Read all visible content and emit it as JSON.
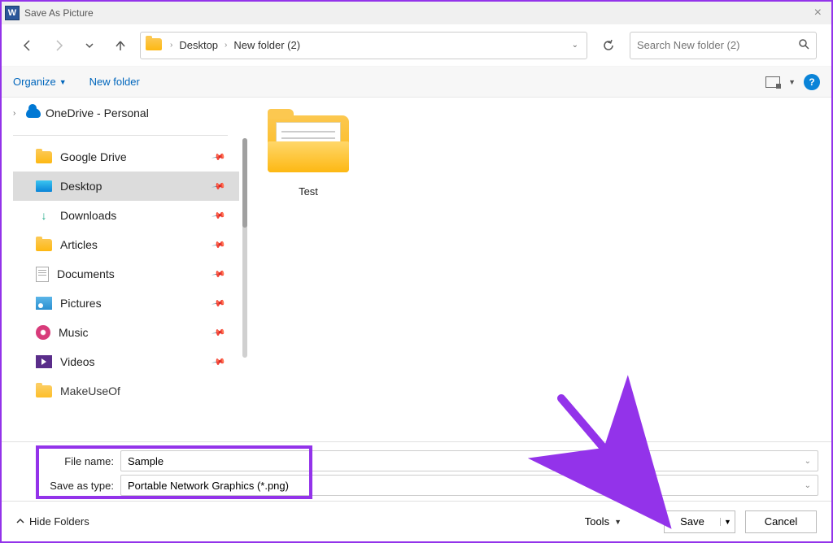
{
  "window": {
    "title": "Save As Picture"
  },
  "breadcrumb": {
    "items": [
      "Desktop",
      "New folder (2)"
    ]
  },
  "search": {
    "placeholder": "Search New folder (2)"
  },
  "toolbar": {
    "organize": "Organize",
    "new_folder": "New folder"
  },
  "tree": {
    "onedrive": "OneDrive - Personal"
  },
  "quick_access": [
    {
      "label": "Google Drive",
      "icon": "folder"
    },
    {
      "label": "Desktop",
      "icon": "desktop",
      "active": true
    },
    {
      "label": "Downloads",
      "icon": "download"
    },
    {
      "label": "Articles",
      "icon": "folder"
    },
    {
      "label": "Documents",
      "icon": "doc"
    },
    {
      "label": "Pictures",
      "icon": "pic"
    },
    {
      "label": "Music",
      "icon": "music"
    },
    {
      "label": "Videos",
      "icon": "video"
    },
    {
      "label": "MakeUseOf",
      "icon": "folder"
    }
  ],
  "content": {
    "items": [
      {
        "label": "Test",
        "type": "folder"
      }
    ]
  },
  "fields": {
    "filename_label": "File name:",
    "filename_value": "Sample",
    "savetype_label": "Save as type:",
    "savetype_value": "Portable Network Graphics (*.png)"
  },
  "footer": {
    "hide_folders": "Hide Folders",
    "tools": "Tools",
    "save": "Save",
    "cancel": "Cancel"
  },
  "annotation": {
    "highlight_color": "#9333ea",
    "arrow_color": "#9333ea"
  }
}
